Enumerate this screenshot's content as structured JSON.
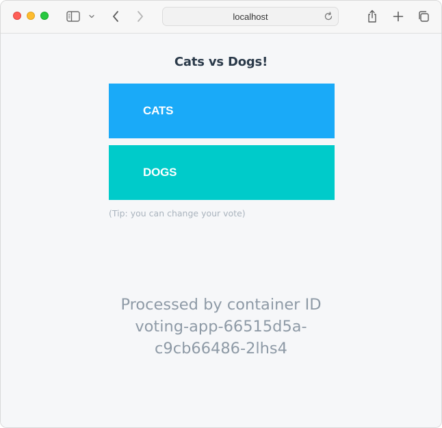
{
  "browser": {
    "address": "localhost"
  },
  "page": {
    "title": "Cats vs Dogs!",
    "options": [
      {
        "label": "CATS",
        "color": "#1aaaf8"
      },
      {
        "label": "DOGS",
        "color": "#00cbca"
      }
    ],
    "tip": "(Tip: you can change your vote)",
    "processed_lines": [
      "Processed by container ID",
      "voting-app-66515d5a-",
      "c9cb66486-2lhs4"
    ]
  },
  "colors": {
    "cats": "#1aaaf8",
    "dogs": "#00cbca",
    "title": "#2b3a4a",
    "muted": "#8e9aa6",
    "background": "#f6f7f9"
  },
  "icons": [
    "sidebar-icon",
    "chevron-down-icon",
    "back-icon",
    "forward-icon",
    "reload-icon",
    "share-icon",
    "plus-icon",
    "tabs-icon"
  ]
}
